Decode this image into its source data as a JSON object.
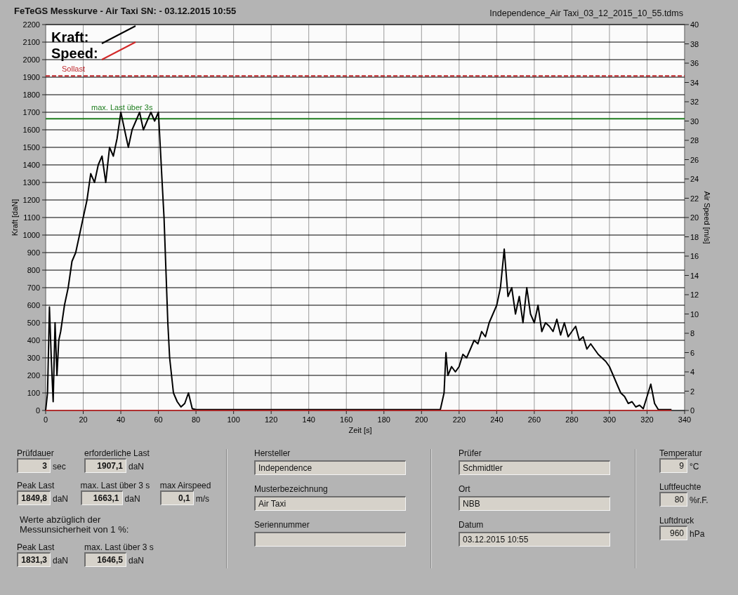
{
  "header": {
    "title": "FeTeGS Messkurve - Air Taxi  SN:  - 03.12.2015 10:55",
    "file": "Independence_Air Taxi_03_12_2015_10_55.tdms"
  },
  "chart": {
    "chart_data": {
      "type": "line",
      "xlabel": "Zeit [s]",
      "ylabel": "Kraft [daN]",
      "y2label": "Air Speed [m/s]",
      "xlim": [
        0,
        340
      ],
      "ylim": [
        0,
        2200
      ],
      "y2lim": [
        0,
        40
      ],
      "xticks": [
        0,
        20,
        40,
        60,
        80,
        100,
        120,
        140,
        160,
        180,
        200,
        220,
        240,
        260,
        280,
        300,
        320,
        340
      ],
      "yticks": [
        0,
        100,
        200,
        300,
        400,
        500,
        600,
        700,
        800,
        900,
        1000,
        1100,
        1200,
        1300,
        1400,
        1500,
        1600,
        1700,
        1800,
        1900,
        2000,
        2100,
        2200
      ],
      "y2ticks": [
        0,
        2,
        4,
        6,
        8,
        10,
        12,
        14,
        16,
        18,
        20,
        22,
        24,
        26,
        28,
        30,
        32,
        34,
        36,
        38,
        40
      ],
      "x": [
        0,
        1,
        2,
        3,
        4,
        5,
        6,
        7,
        8,
        10,
        12,
        14,
        16,
        18,
        20,
        22,
        24,
        26,
        28,
        30,
        32,
        34,
        36,
        38,
        40,
        42,
        44,
        46,
        48,
        50,
        52,
        54,
        56,
        58,
        60,
        61,
        62,
        63,
        64,
        65,
        66,
        68,
        70,
        72,
        74,
        76,
        78,
        80,
        120,
        160,
        210,
        212,
        213,
        214,
        216,
        218,
        220,
        222,
        224,
        226,
        228,
        230,
        232,
        234,
        236,
        238,
        240,
        242,
        244,
        246,
        248,
        250,
        252,
        254,
        256,
        258,
        260,
        262,
        264,
        266,
        268,
        270,
        272,
        274,
        276,
        278,
        280,
        282,
        284,
        286,
        288,
        290,
        292,
        294,
        296,
        298,
        300,
        302,
        304,
        306,
        308,
        310,
        312,
        314,
        316,
        318,
        320,
        322,
        324,
        326,
        330,
        333
      ],
      "series": [
        {
          "name": "Kraft:",
          "color": "#000000",
          "values": [
            0,
            100,
            590,
            300,
            50,
            500,
            200,
            400,
            450,
            600,
            700,
            850,
            900,
            1000,
            1100,
            1200,
            1350,
            1300,
            1400,
            1450,
            1300,
            1500,
            1450,
            1550,
            1700,
            1600,
            1500,
            1600,
            1650,
            1700,
            1600,
            1650,
            1700,
            1650,
            1700,
            1500,
            1300,
            1100,
            800,
            500,
            300,
            100,
            50,
            20,
            40,
            100,
            10,
            5,
            5,
            5,
            5,
            100,
            330,
            200,
            250,
            220,
            250,
            320,
            300,
            350,
            400,
            380,
            450,
            420,
            500,
            550,
            600,
            700,
            920,
            650,
            700,
            550,
            650,
            500,
            700,
            550,
            500,
            600,
            450,
            500,
            480,
            450,
            520,
            430,
            500,
            420,
            450,
            480,
            400,
            420,
            350,
            380,
            350,
            320,
            300,
            280,
            250,
            200,
            150,
            100,
            80,
            40,
            50,
            20,
            30,
            10,
            80,
            150,
            40,
            5,
            5,
            5
          ]
        },
        {
          "name": "Speed:",
          "color": "#d22828",
          "values": [
            0,
            0,
            0,
            0,
            0,
            0,
            0,
            0,
            0,
            0,
            0,
            0,
            0,
            0,
            0,
            0,
            0,
            0,
            0,
            0,
            0,
            0,
            0,
            0,
            0,
            0,
            0,
            0,
            0,
            0,
            0,
            0,
            0,
            0,
            0,
            0,
            0,
            0,
            0,
            0,
            0,
            0,
            0,
            0,
            0,
            0,
            0,
            0,
            0,
            0,
            0,
            0,
            0,
            0,
            0,
            0,
            0,
            0,
            0,
            0,
            0,
            0,
            0,
            0,
            0,
            0,
            0,
            0,
            0,
            0,
            0,
            0,
            0,
            0,
            0,
            0,
            0,
            0,
            0,
            0,
            0,
            0,
            0,
            0,
            0,
            0,
            0,
            0,
            0,
            0,
            0,
            0,
            0,
            0,
            0,
            0,
            0,
            0,
            0,
            0,
            0,
            0,
            0,
            0,
            0,
            0,
            0,
            0,
            0,
            0,
            0,
            0
          ]
        }
      ],
      "ref_lines": [
        {
          "axis": "y",
          "value": 1907.1,
          "label": "Sollast",
          "color": "#c0282d"
        },
        {
          "axis": "y",
          "value": 1663.1,
          "label": "max. Last über 3s",
          "color": "#1e7d1e"
        }
      ],
      "grid": true,
      "legend": true
    }
  },
  "results": [
    {
      "kind": "row",
      "fields": [
        {
          "label": "Prüfdauer",
          "value": "3",
          "unit": "sec"
        },
        {
          "label": "erforderliche Last",
          "value": "1907,1",
          "unit": "daN"
        }
      ]
    },
    {
      "kind": "row",
      "fields": [
        {
          "label": "Peak Last",
          "value": "1849,8",
          "unit": "daN"
        },
        {
          "label": "max. Last über  3 s",
          "value": "1663,1",
          "unit": "daN"
        },
        {
          "label": "max Airspeed",
          "value": "0,1",
          "unit": "m/s"
        }
      ]
    },
    {
      "kind": "note",
      "lines": [
        "Werte abzüglich der",
        "Messunsicherheit von 1  %:"
      ]
    },
    {
      "kind": "row",
      "fields": [
        {
          "label": "Peak Last",
          "value": "1831,3",
          "unit": "daN"
        },
        {
          "label": "max. Last über  3 s",
          "value": "1646,5",
          "unit": "daN"
        }
      ]
    }
  ],
  "info_columns": [
    [
      {
        "label": "Hersteller",
        "value": "Independence"
      },
      {
        "label": "Musterbezeichnung",
        "value": "Air Taxi"
      },
      {
        "label": "Seriennummer"
      }
    ],
    [
      {
        "label": "Prüfer",
        "value": "Schmidtler"
      },
      {
        "label": "Ort",
        "value": "NBB"
      },
      {
        "label": "Datum",
        "value": "03.12.2015 10:55"
      }
    ]
  ],
  "ambient": [
    {
      "label": "Temperatur",
      "value": "9",
      "unit": "°C"
    },
    {
      "label": "Luftfeuchte",
      "value": "80",
      "unit": "%r.F."
    },
    {
      "label": "Luftdruck",
      "value": "960",
      "unit": "hPa"
    }
  ]
}
